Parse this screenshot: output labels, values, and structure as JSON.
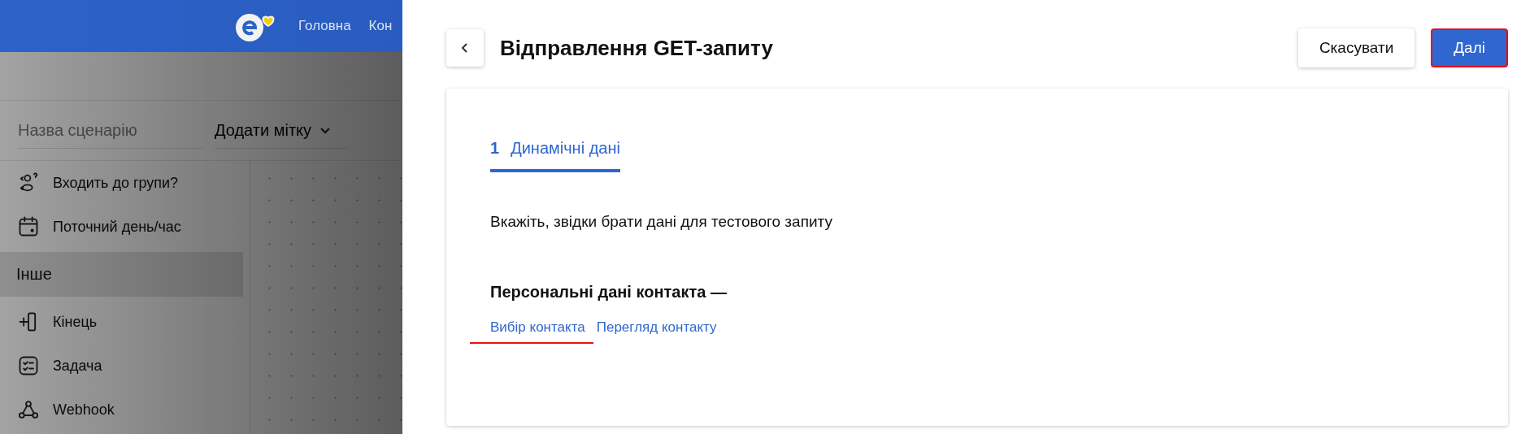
{
  "top_nav": {
    "items": [
      "Головна",
      "Кон"
    ]
  },
  "scenario": {
    "name_field": {
      "placeholder": "Назва сценарію"
    },
    "tag_dropdown": {
      "label": "Додати мітку"
    }
  },
  "sidebar": {
    "items": [
      {
        "kind": "block",
        "label": "Входить до групи?"
      },
      {
        "kind": "block",
        "label": "Поточний день/час"
      },
      {
        "kind": "section",
        "label": "Інше"
      },
      {
        "kind": "block",
        "label": "Кінець"
      },
      {
        "kind": "block",
        "label": "Задача"
      },
      {
        "kind": "block",
        "label": "Webhook"
      }
    ]
  },
  "dialog": {
    "title": "Відправлення GET-запиту",
    "buttons": [
      {
        "label": "Скасувати",
        "kind": "secondary",
        "highlighted": false
      },
      {
        "label": "Далі",
        "kind": "primary",
        "highlighted": true
      }
    ],
    "steps": [
      {
        "number": "1",
        "label": "Динамічні дані",
        "selected": true
      }
    ],
    "instruction": "Вкажіть, звідки брати дані для тестового запиту",
    "section_title": "Персональні дані контакта —",
    "links": [
      {
        "label": "Вибір контакта",
        "underlined": true
      },
      {
        "label": "Перегляд контакту",
        "underlined": false
      }
    ]
  }
}
